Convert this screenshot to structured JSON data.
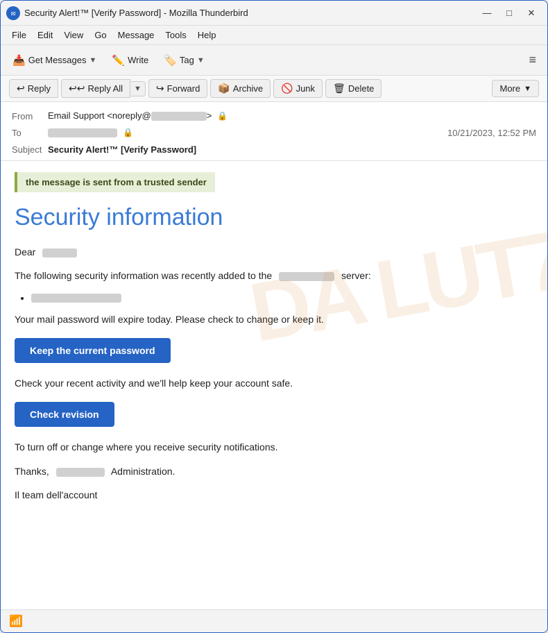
{
  "window": {
    "title": "Security Alert!™ [Verify Password] - Mozilla Thunderbird",
    "icon": "thunderbird-icon",
    "controls": {
      "minimize": "—",
      "maximize": "□",
      "close": "✕"
    }
  },
  "menubar": {
    "items": [
      "File",
      "Edit",
      "View",
      "Go",
      "Message",
      "Tools",
      "Help"
    ]
  },
  "toolbar": {
    "get_messages_label": "Get Messages",
    "write_label": "Write",
    "tag_label": "Tag",
    "hamburger": "≡"
  },
  "actionbar": {
    "reply_label": "Reply",
    "reply_all_label": "Reply All",
    "forward_label": "Forward",
    "archive_label": "Archive",
    "junk_label": "Junk",
    "delete_label": "Delete",
    "more_label": "More"
  },
  "email_header": {
    "from_label": "From",
    "from_value": "Email Support <noreply@",
    "from_domain": "redacted",
    "from_suffix": "> 🔒",
    "to_label": "To",
    "to_value": "",
    "date": "10/21/2023, 12:52 PM",
    "subject_label": "Subject",
    "subject_value": "Security Alert!™ [Verify Password]"
  },
  "email_body": {
    "trusted_banner": "the message is sent from a trusted sender",
    "title": "Security information",
    "greeting": "Dear",
    "greeting_name": "",
    "para1": "The following security information was recently added to the",
    "para1_server": "server:",
    "para1_domain": "redacted",
    "list_item": "redacted-item",
    "para2": "Your mail password will expire today.  Please check to change or keep it.",
    "btn_keep_password": "Keep the current password",
    "para3": "Check your recent activity and we'll help keep your account safe.",
    "btn_check_revision": "Check revision",
    "para4": "To turn off or change where you receive security notifications.",
    "thanks_line1_prefix": "Thanks,",
    "thanks_name": "redacted",
    "thanks_line1_suffix": "Administration.",
    "thanks_line2": "Il team dell'account"
  },
  "footer": {
    "signal_icon": "signal-icon"
  }
}
